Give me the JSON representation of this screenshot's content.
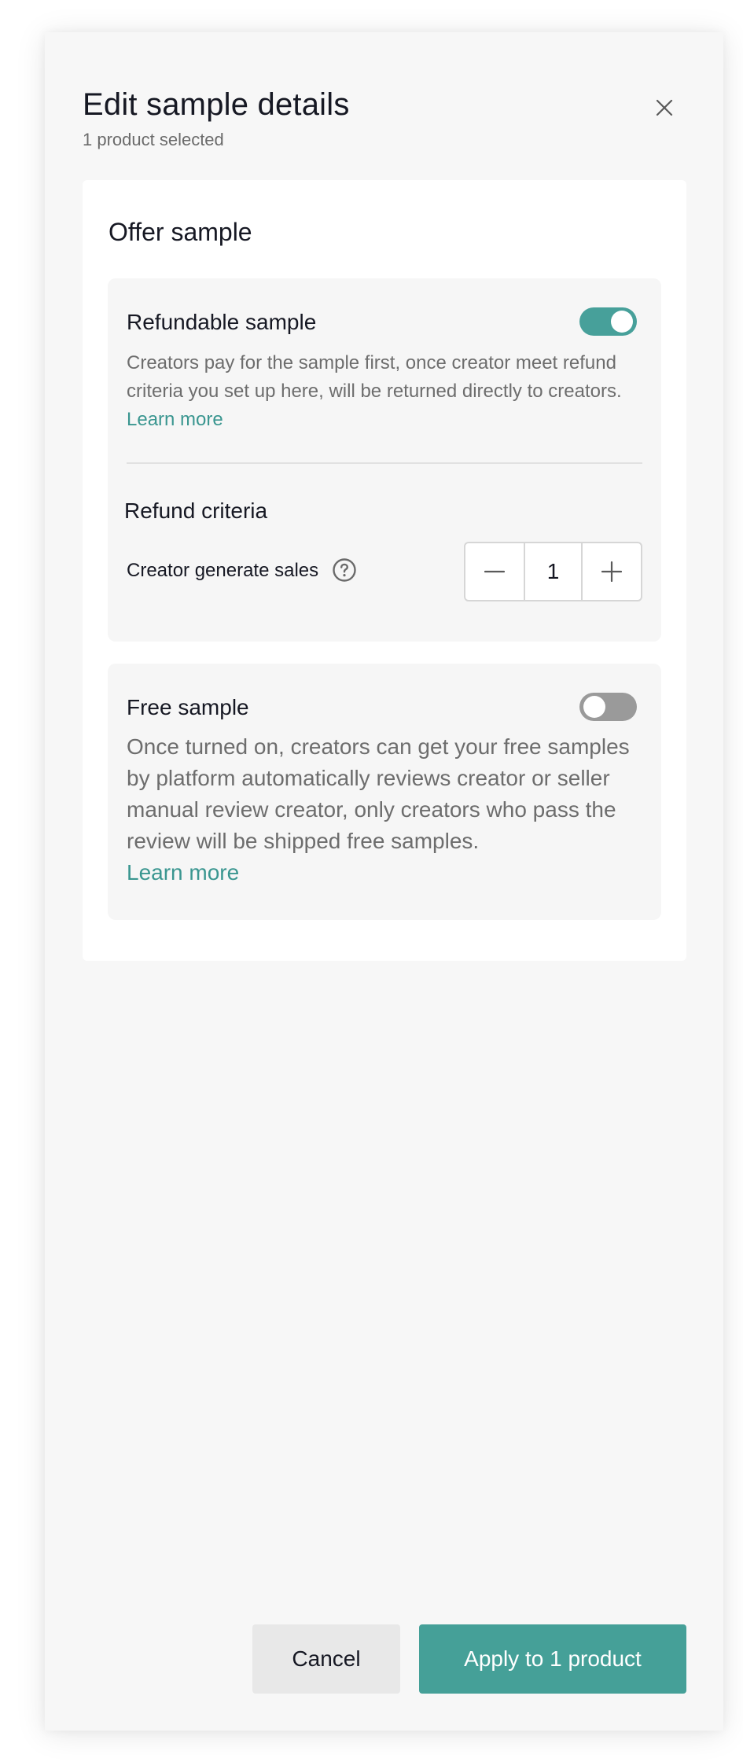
{
  "dialog": {
    "title": "Edit sample details",
    "subtitle": "1 product selected"
  },
  "offer": {
    "title": "Offer sample",
    "refundable": {
      "title": "Refundable sample",
      "enabled": true,
      "description": "Creators pay for the sample first, once creator meet refund criteria you set up here, will be returned directly to creators.",
      "link": "Learn more",
      "criteria_title": "Refund criteria",
      "criteria_label": "Creator generate sales",
      "quantity": "1"
    },
    "free": {
      "title": "Free sample",
      "enabled": false,
      "description": "Once turned on, creators can get your free samples by platform automatically reviews creator or seller manual review creator, only creators who pass the review will be shipped free samples.",
      "link": "Learn more"
    }
  },
  "footer": {
    "cancel_label": "Cancel",
    "apply_label": "Apply to 1 product"
  },
  "colors": {
    "accent": "#45a098",
    "toggle_off": "#9a9a9a"
  },
  "icons": [
    "close-icon",
    "help-circle-icon",
    "minus-icon",
    "plus-icon"
  ]
}
